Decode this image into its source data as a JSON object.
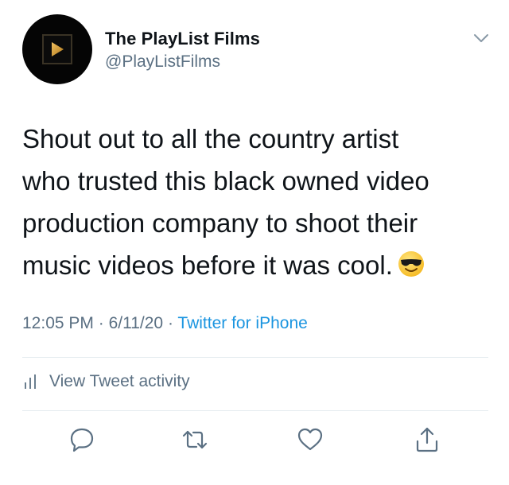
{
  "header": {
    "display_name": "The PlayList Films",
    "handle": "@PlayListFilms",
    "avatar_icon": "play-triangle-logo",
    "menu_icon": "chevron-down-icon"
  },
  "tweet": {
    "text": "Shout out to all the country artist\nwho trusted this black owned video\nproduction company to shoot their\nmusic videos before it was cool.",
    "emoji": "smiling-face-with-sunglasses",
    "time": "12:05 PM",
    "separator": "·",
    "date": "6/11/20",
    "source": "Twitter for iPhone"
  },
  "activity": {
    "label": "View Tweet activity",
    "icon": "bar-chart-icon"
  },
  "actions": [
    {
      "name": "reply",
      "icon": "speech-bubble-icon"
    },
    {
      "name": "retweet",
      "icon": "retweet-icon"
    },
    {
      "name": "like",
      "icon": "heart-icon"
    },
    {
      "name": "share",
      "icon": "share-icon"
    }
  ],
  "colors": {
    "text": "#0f1419",
    "secondary": "#5b7083",
    "link": "#1b95e0",
    "divider": "#e6ecf0",
    "logo_gold": "#d49a2a"
  }
}
